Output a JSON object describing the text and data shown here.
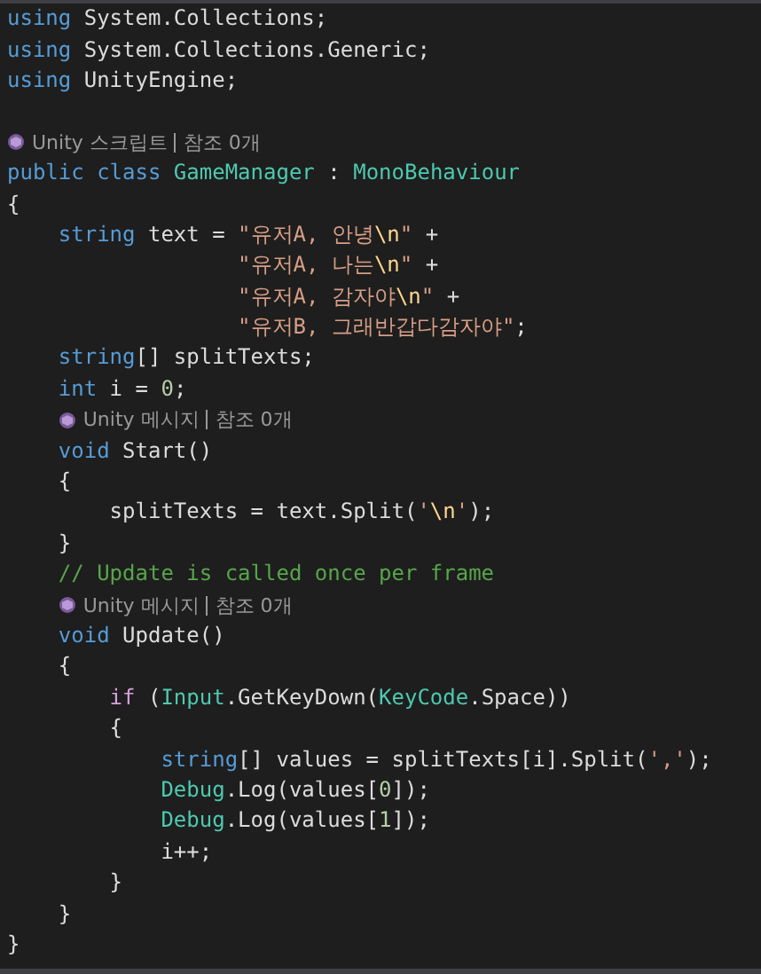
{
  "editor": {
    "lines": [
      {
        "kind": "code",
        "tokens": [
          {
            "kind": "keyword",
            "text": "using"
          },
          {
            "kind": "plain",
            "text": " System.Collections;"
          }
        ]
      },
      {
        "kind": "code",
        "tokens": [
          {
            "kind": "keyword",
            "text": "using"
          },
          {
            "kind": "plain",
            "text": " System.Collections.Generic;"
          }
        ]
      },
      {
        "kind": "code",
        "tokens": [
          {
            "kind": "keyword",
            "text": "using"
          },
          {
            "kind": "plain",
            "text": " UnityEngine;"
          }
        ]
      },
      {
        "kind": "blank"
      },
      {
        "kind": "codelens",
        "items": [
          "Unity 스크립트",
          "참조 0개"
        ]
      },
      {
        "kind": "code",
        "tokens": [
          {
            "kind": "keyword",
            "text": "public class"
          },
          {
            "kind": "type",
            "text": " GameManager"
          },
          {
            "kind": "plain",
            "text": " : "
          },
          {
            "kind": "type",
            "text": "MonoBehaviour"
          }
        ]
      },
      {
        "kind": "code",
        "tokens": [
          {
            "kind": "plain",
            "text": "{"
          }
        ]
      },
      {
        "kind": "code",
        "tokens": [
          {
            "kind": "keyword",
            "text": "    string"
          },
          {
            "kind": "plain",
            "text": " text = "
          },
          {
            "kind": "string",
            "text": "\"유저A, 안녕"
          },
          {
            "kind": "escape",
            "text": "\\n"
          },
          {
            "kind": "string",
            "text": "\""
          },
          {
            "kind": "plain",
            "text": " +"
          }
        ]
      },
      {
        "kind": "code",
        "tokens": [
          {
            "kind": "string",
            "text": "                  \"유저A, 나는"
          },
          {
            "kind": "escape",
            "text": "\\n"
          },
          {
            "kind": "string",
            "text": "\""
          },
          {
            "kind": "plain",
            "text": " +"
          }
        ]
      },
      {
        "kind": "code",
        "tokens": [
          {
            "kind": "string",
            "text": "                  \"유저A, 감자야"
          },
          {
            "kind": "escape",
            "text": "\\n"
          },
          {
            "kind": "string",
            "text": "\""
          },
          {
            "kind": "plain",
            "text": " +"
          }
        ]
      },
      {
        "kind": "code",
        "tokens": [
          {
            "kind": "string",
            "text": "                  \"유저B, 그래반갑다감자야\""
          },
          {
            "kind": "plain",
            "text": ";"
          }
        ]
      },
      {
        "kind": "code",
        "tokens": [
          {
            "kind": "keyword",
            "text": "    string"
          },
          {
            "kind": "plain",
            "text": "[] splitTexts;"
          }
        ]
      },
      {
        "kind": "code",
        "tokens": [
          {
            "kind": "keyword",
            "text": "    int"
          },
          {
            "kind": "plain",
            "text": " i = "
          },
          {
            "kind": "number",
            "text": "0"
          },
          {
            "kind": "plain",
            "text": ";"
          }
        ]
      },
      {
        "kind": "codelens",
        "items": [
          "Unity 메시지",
          "참조 0개"
        ]
      },
      {
        "kind": "code",
        "tokens": [
          {
            "kind": "keyword",
            "text": "    void"
          },
          {
            "kind": "method",
            "text": " Start"
          },
          {
            "kind": "plain",
            "text": "()"
          }
        ]
      },
      {
        "kind": "code",
        "tokens": [
          {
            "kind": "plain",
            "text": "    {"
          }
        ]
      },
      {
        "kind": "code",
        "tokens": [
          {
            "kind": "plain",
            "text": "        splitTexts = text.Split("
          },
          {
            "kind": "string",
            "text": "'"
          },
          {
            "kind": "escape",
            "text": "\\n"
          },
          {
            "kind": "string",
            "text": "'"
          },
          {
            "kind": "plain",
            "text": ");"
          }
        ]
      },
      {
        "kind": "code",
        "tokens": [
          {
            "kind": "plain",
            "text": "    }"
          }
        ]
      },
      {
        "kind": "code",
        "tokens": [
          {
            "kind": "comment",
            "text": "    // Update is called once per frame"
          }
        ]
      },
      {
        "kind": "codelens",
        "items": [
          "Unity 메시지",
          "참조 0개"
        ]
      },
      {
        "kind": "code",
        "tokens": [
          {
            "kind": "keyword",
            "text": "    void"
          },
          {
            "kind": "method",
            "text": " Update"
          },
          {
            "kind": "plain",
            "text": "()"
          }
        ]
      },
      {
        "kind": "code",
        "tokens": [
          {
            "kind": "plain",
            "text": "    {"
          }
        ]
      },
      {
        "kind": "code",
        "tokens": [
          {
            "kind": "control",
            "text": "        if"
          },
          {
            "kind": "plain",
            "text": " ("
          },
          {
            "kind": "type",
            "text": "Input"
          },
          {
            "kind": "plain",
            "text": ".GetKeyDown("
          },
          {
            "kind": "type",
            "text": "KeyCode"
          },
          {
            "kind": "plain",
            "text": ".Space))"
          }
        ]
      },
      {
        "kind": "code",
        "tokens": [
          {
            "kind": "plain",
            "text": "        {"
          }
        ]
      },
      {
        "kind": "code",
        "tokens": [
          {
            "kind": "keyword",
            "text": "            string"
          },
          {
            "kind": "plain",
            "text": "[] values = splitTexts[i].Split("
          },
          {
            "kind": "string",
            "text": "','"
          },
          {
            "kind": "plain",
            "text": ");"
          }
        ]
      },
      {
        "kind": "code",
        "tokens": [
          {
            "kind": "type",
            "text": "            Debug"
          },
          {
            "kind": "plain",
            "text": ".Log(values["
          },
          {
            "kind": "number",
            "text": "0"
          },
          {
            "kind": "plain",
            "text": "]);"
          }
        ]
      },
      {
        "kind": "code",
        "tokens": [
          {
            "kind": "type",
            "text": "            Debug"
          },
          {
            "kind": "plain",
            "text": ".Log(values["
          },
          {
            "kind": "number",
            "text": "1"
          },
          {
            "kind": "plain",
            "text": "]);"
          }
        ]
      },
      {
        "kind": "code",
        "tokens": [
          {
            "kind": "plain",
            "text": "            i++;"
          }
        ]
      },
      {
        "kind": "code",
        "tokens": [
          {
            "kind": "plain",
            "text": "        }"
          }
        ]
      },
      {
        "kind": "code",
        "tokens": [
          {
            "kind": "plain",
            "text": "    }"
          }
        ]
      },
      {
        "kind": "code",
        "tokens": [
          {
            "kind": "plain",
            "text": "}"
          }
        ]
      }
    ]
  }
}
